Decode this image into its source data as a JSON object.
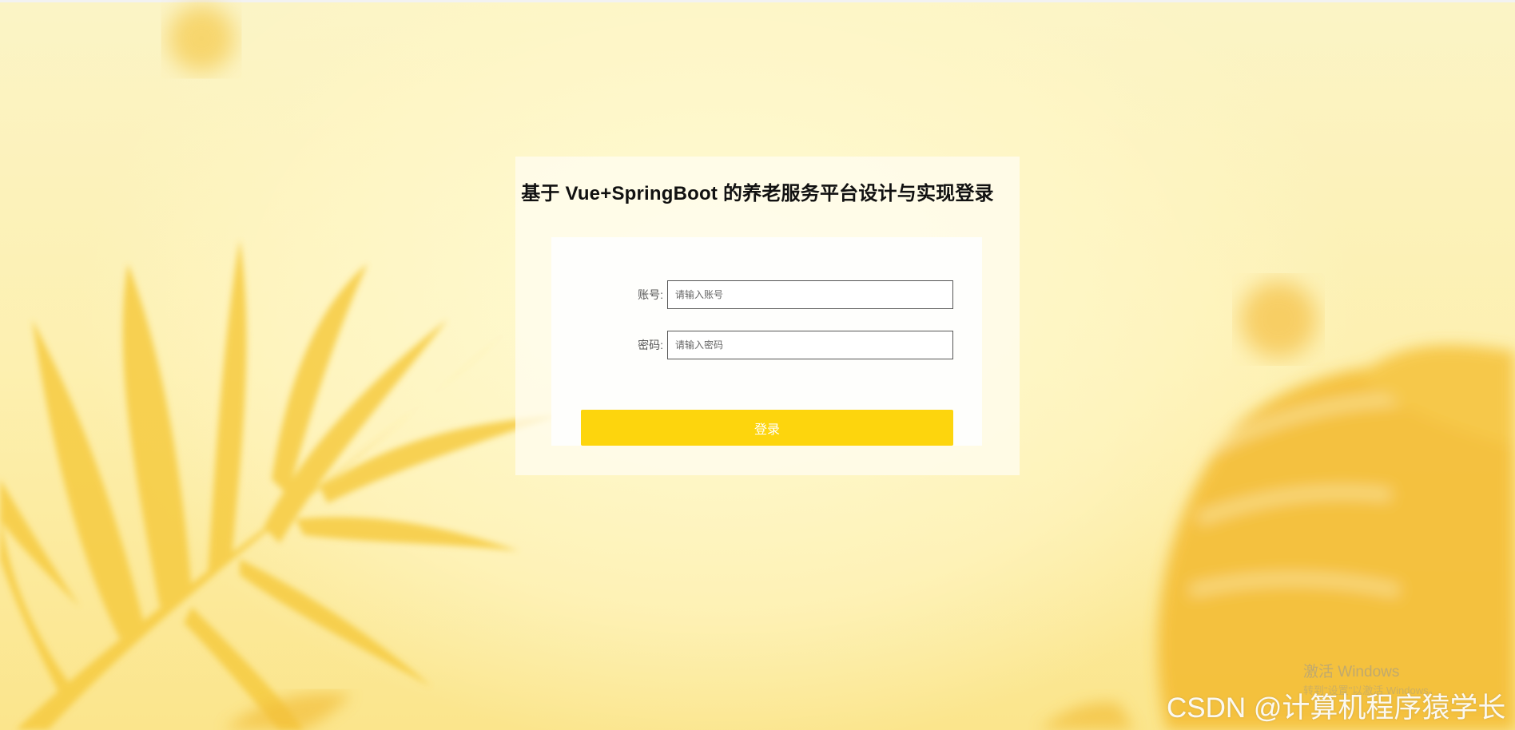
{
  "page": {
    "title": "基于 Vue+SpringBoot 的养老服务平台设计与实现登录"
  },
  "form": {
    "account_label": "账号:",
    "account_placeholder": "请输入账号",
    "account_value": "",
    "password_label": "密码:",
    "password_placeholder": "请输入密码",
    "password_value": "",
    "login_button": "登录"
  },
  "watermarks": {
    "windows_activate": "激活 Windows",
    "windows_activate_hint": "转到\"设置\"以激活 Windows。",
    "csdn": "CSDN @计算机程序猿学长"
  },
  "colors": {
    "accent": "#fdd50d",
    "background": "#fdeeaa"
  }
}
